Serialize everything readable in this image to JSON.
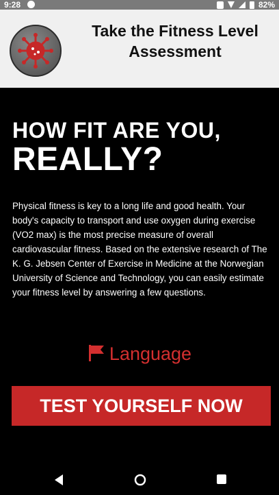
{
  "status_bar": {
    "time": "9:28",
    "battery": "82%"
  },
  "header": {
    "title_line1": "Take the Fitness Level",
    "title_line2": "Assessment"
  },
  "main": {
    "headline_line1": "HOW FIT ARE YOU,",
    "headline_line2": "REALLY?",
    "intro_text": "Physical fitness is key to a long life and good health. Your body's capacity to transport and use oxygen during exercise (VO2 max) is the most precise measure of overall cardiovascular fitness. Based on the extensive research of The K. G. Jebsen Center of Exercise in Medicine at the Norwegian University of Science and Technology, you can easily estimate your fitness level by answering a few questions.",
    "language_label": "Language",
    "test_button_label": "TEST YOURSELF NOW"
  },
  "colors": {
    "accent_red": "#c62828",
    "header_bg": "#f0f0f0",
    "background": "#000000"
  },
  "icons": {
    "logo": "virus-logo-icon",
    "language": "flag-icon",
    "nav_back": "back-triangle-icon",
    "nav_home": "home-circle-icon",
    "nav_recent": "recent-square-icon"
  }
}
